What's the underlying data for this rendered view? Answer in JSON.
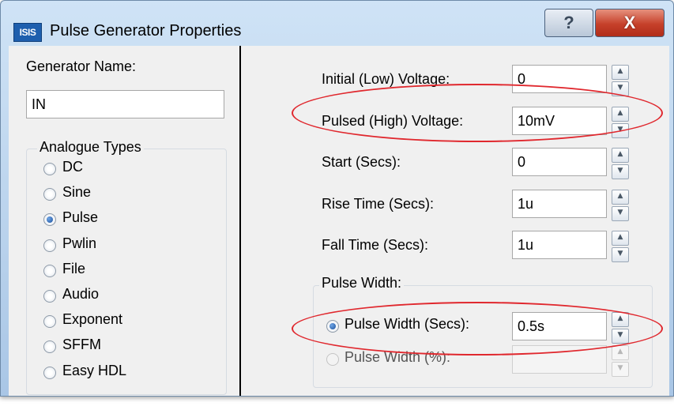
{
  "window": {
    "title": "Pulse Generator Properties",
    "app_icon_text": "ISIS",
    "help_label": "?",
    "close_label": "X"
  },
  "left": {
    "generator_name_label": "Generator Name:",
    "generator_name_value": "IN",
    "analogue_types_title": "Analogue Types",
    "types": [
      {
        "label": "DC",
        "selected": false
      },
      {
        "label": "Sine",
        "selected": false
      },
      {
        "label": "Pulse",
        "selected": true
      },
      {
        "label": "Pwlin",
        "selected": false
      },
      {
        "label": "File",
        "selected": false
      },
      {
        "label": "Audio",
        "selected": false
      },
      {
        "label": "Exponent",
        "selected": false
      },
      {
        "label": "SFFM",
        "selected": false
      },
      {
        "label": "Easy HDL",
        "selected": false
      }
    ]
  },
  "right": {
    "fields": [
      {
        "label": "Initial (Low) Voltage:",
        "value": "0"
      },
      {
        "label": "Pulsed (High) Voltage:",
        "value": "10mV"
      },
      {
        "label": "Start (Secs):",
        "value": "0"
      },
      {
        "label": "Rise Time (Secs):",
        "value": "1u"
      },
      {
        "label": "Fall Time (Secs):",
        "value": "1u"
      }
    ],
    "pulse_width_title": "Pulse Width:",
    "pulse_width_secs_label": "Pulse Width (Secs):",
    "pulse_width_secs_value": "0.5s",
    "pulse_width_secs_selected": true,
    "pulse_width_pct_label": "Pulse Width (%):",
    "pulse_width_pct_value": ""
  },
  "colors": {
    "highlight_ellipse": "#e0282e",
    "titlebar": "#b9d2ec",
    "close_button": "#c6402a",
    "dialog_background": "#f0f0f0"
  },
  "icons": {
    "spinner_up": "▲",
    "spinner_down": "▼"
  }
}
